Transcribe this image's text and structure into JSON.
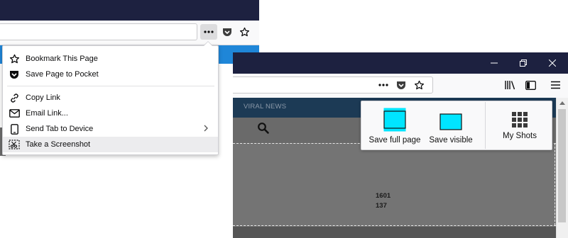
{
  "left_window": {
    "page_actions_icon": "more-dots-icon",
    "pocket_icon": "pocket-icon",
    "bookmark_star_icon": "star-icon"
  },
  "page_actions_menu": {
    "items": [
      {
        "label": "Bookmark This Page",
        "icon": "star-icon"
      },
      {
        "label": "Save Page to Pocket",
        "icon": "pocket-icon"
      },
      {
        "label": "Copy Link",
        "icon": "link-icon"
      },
      {
        "label": "Email Link...",
        "icon": "mail-icon"
      },
      {
        "label": "Send Tab to Device",
        "icon": "device-icon",
        "has_submenu": true
      },
      {
        "label": "Take a Screenshot",
        "icon": "screenshot-icon",
        "highlighted": true
      }
    ]
  },
  "right_window": {
    "window_controls": [
      "minimize-icon",
      "restore-icon",
      "close-icon"
    ],
    "toolbar_icons": [
      "more-dots-icon",
      "pocket-icon",
      "star-icon",
      "library-icon",
      "sidebar-icon",
      "hamburger-menu-icon"
    ],
    "nav_link": "VIRAL NEWS",
    "selection_width": "1601",
    "selection_height": "137",
    "screenshot_options": [
      {
        "label": "Save full page",
        "icon": "full-page-icon"
      },
      {
        "label": "Save visible",
        "icon": "visible-area-icon"
      },
      {
        "label": "My Shots",
        "icon": "grid-icon"
      }
    ],
    "accent_color": "#00e5ff"
  }
}
